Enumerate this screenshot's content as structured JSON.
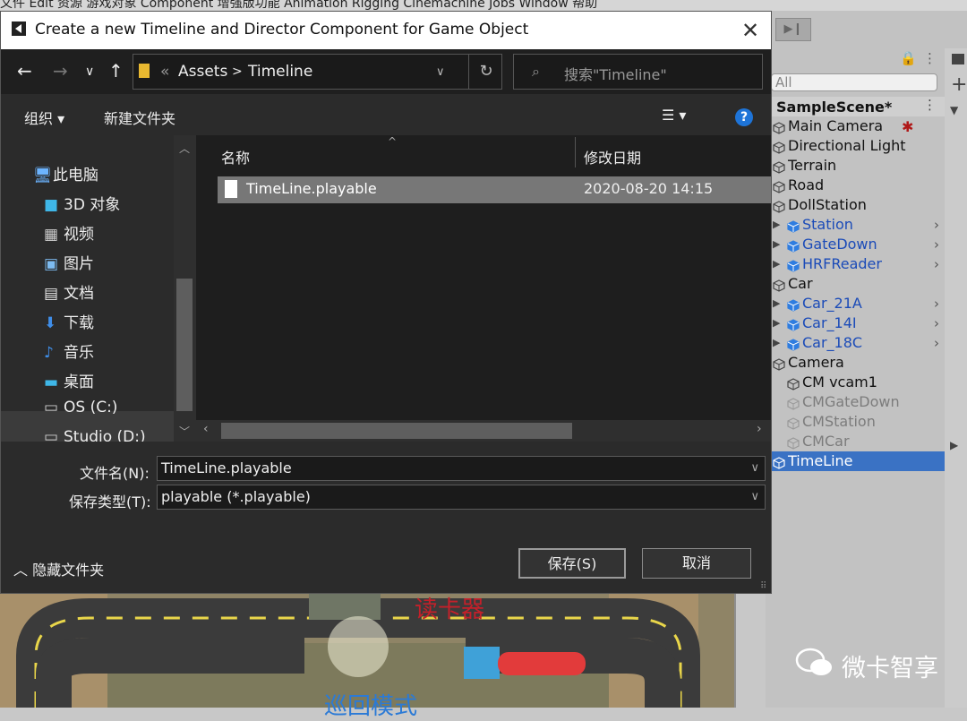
{
  "menubar": {
    "text": "文件   Edit   资源   游戏对象   Component   增强版功能   Animation Rigging   Cinemachine   Jobs   Window   帮助"
  },
  "hierarchy": {
    "search_placeholder": "All",
    "scene_name": "SampleScene*",
    "items": [
      {
        "label": "Main Camera"
      },
      {
        "label": "Directional Light"
      },
      {
        "label": "Terrain"
      },
      {
        "label": "Road"
      },
      {
        "label": "DollStation"
      },
      {
        "label": "Station"
      },
      {
        "label": "GateDown"
      },
      {
        "label": "HRFReader"
      },
      {
        "label": "Car"
      },
      {
        "label": "Car_21A"
      },
      {
        "label": "Car_14I"
      },
      {
        "label": "Car_18C"
      },
      {
        "label": "Camera"
      },
      {
        "label": "CM vcam1"
      },
      {
        "label": "CMGateDown"
      },
      {
        "label": "CMStation"
      },
      {
        "label": "CMCar"
      },
      {
        "label": "TimeLine"
      }
    ]
  },
  "scene": {
    "overlay_label": "读卡器",
    "overlay_bottom": "巡回模式"
  },
  "watermark": {
    "text": "微卡智享"
  },
  "dialog": {
    "title": "Create a new Timeline and Director Component for Game Object",
    "breadcrumb": {
      "sep": "«",
      "root": "Assets",
      "arrow": ">",
      "folder": "Timeline"
    },
    "search_placeholder": "搜索\"Timeline\"",
    "commands": {
      "organize": "组织 ▾",
      "new_folder": "新建文件夹",
      "help": "?"
    },
    "nav_tree": [
      {
        "icon": "🖥",
        "label": "此电脑"
      },
      {
        "icon": "■",
        "label": "3D 对象"
      },
      {
        "icon": "▦",
        "label": "视频"
      },
      {
        "icon": "▣",
        "label": "图片"
      },
      {
        "icon": "▤",
        "label": "文档"
      },
      {
        "icon": "⬇",
        "label": "下载"
      },
      {
        "icon": "♪",
        "label": "音乐"
      },
      {
        "icon": "▬",
        "label": "桌面"
      },
      {
        "icon": "▭",
        "label": "OS (C:)"
      },
      {
        "icon": "▭",
        "label": "Studio (D:)"
      }
    ],
    "columns": {
      "name": "名称",
      "date": "修改日期"
    },
    "file": {
      "name": "TimeLine.playable",
      "date": "2020-08-20 14:15"
    },
    "filename_label": "文件名(N):",
    "filename_value": "TimeLine.playable",
    "filetype_label": "保存类型(T):",
    "filetype_value": "playable (*.playable)",
    "hide_folders": "隐藏文件夹",
    "save": "保存(S)",
    "cancel": "取消"
  },
  "colors": {
    "selection": "#3a72c4",
    "prefab_blue": "#1b4bb8",
    "dialog_bg": "#2b2b2b"
  }
}
